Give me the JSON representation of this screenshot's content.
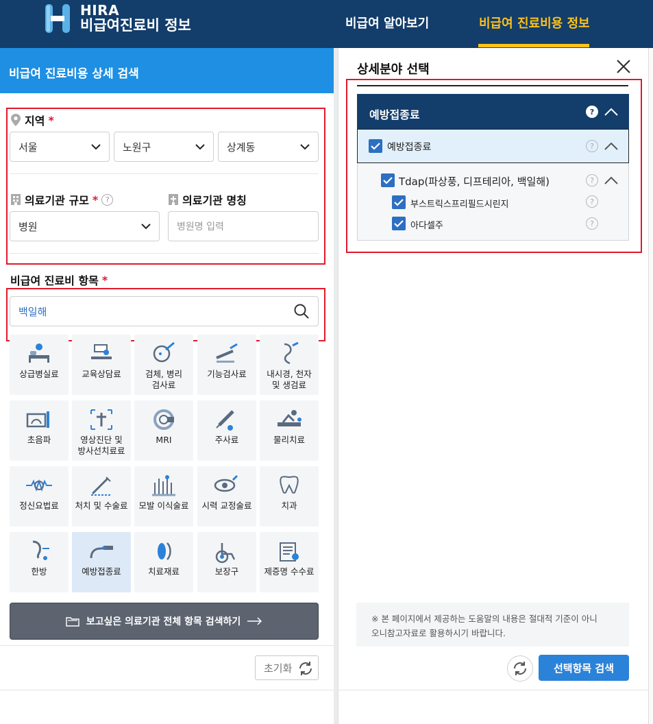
{
  "header": {
    "brand_line1": "HIRA",
    "brand_line2": "비급여진료비 정보",
    "nav": [
      "비급여 알아보기",
      "비급여 진료비용 정보"
    ]
  },
  "left": {
    "title": "비급여 진료비용 상세 검색",
    "region": {
      "label": "지역",
      "city": "서울",
      "district": "노원구",
      "neighborhood": "상계동"
    },
    "scale": {
      "label": "의료기관 규모",
      "value": "병원"
    },
    "name": {
      "label": "의료기관 명칭",
      "placeholder": "병원명 입력"
    },
    "item": {
      "label": "비급여 진료비 항목",
      "search_value": "백일해"
    },
    "categories": [
      "상급병실료",
      "교육상담료",
      "검체, 병리\n검사료",
      "기능검사료",
      "내시경, 천자\n및 생검료",
      "초음파",
      "영상진단 및\n방사선치료료",
      "MRI",
      "주사료",
      "물리치료",
      "정신요법료",
      "처치 및 수술료",
      "모발 이식술료",
      "시력 교정술료",
      "치과",
      "한방",
      "예방접종료",
      "치료재료",
      "보장구",
      "제증명 수수료"
    ],
    "selected_category": "예방접종료",
    "browse_button": "보고싶은 의료기관 전체 항목 검색하기",
    "reset_button": "초기화"
  },
  "right": {
    "title": "상세분야 선택",
    "tree": {
      "root": "예방접종료",
      "level1": "예방접종료",
      "level2": "Tdap(파상풍, 디프테리아, 백일해)",
      "leaves": [
        "부스트릭스프리필드시린지",
        "아다셀주"
      ]
    },
    "notice": "※ 본 페이지에서 제공하는 도움말의 내용은 절대적 기준이 아니",
    "notice2": "오니참고자료로 활용하시기 바랍니다.",
    "submit_button": "선택항목 검색"
  },
  "colors": {
    "navy": "#133d6a",
    "accent_blue": "#1e8fe2",
    "highlight": "#ffc21a",
    "warning_red": "#e0182c"
  }
}
